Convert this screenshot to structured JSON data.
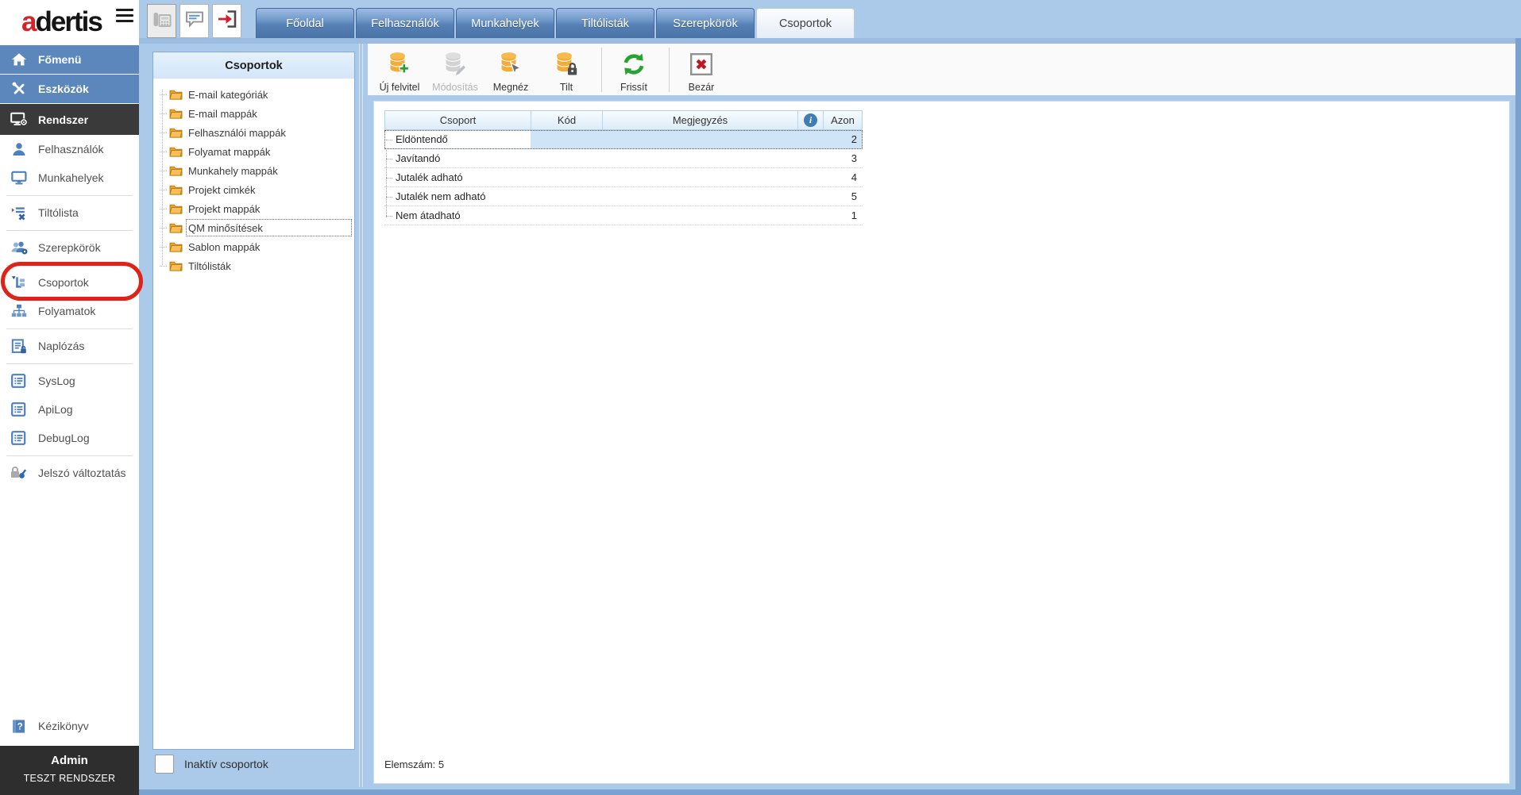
{
  "brand": {
    "logo_red": "a",
    "logo_rest": "dertis"
  },
  "topbar": {
    "window_icons": [
      "fax-icon",
      "comment-icon",
      "logout-icon"
    ],
    "tabs": [
      {
        "label": "Főoldal",
        "active": false
      },
      {
        "label": "Felhasználók",
        "active": false
      },
      {
        "label": "Munkahelyek",
        "active": false
      },
      {
        "label": "Tiltólisták",
        "active": false
      },
      {
        "label": "Szerepkörök",
        "active": false
      },
      {
        "label": "Csoportok",
        "active": true
      }
    ]
  },
  "sidebar": {
    "items": [
      {
        "label": "Főmenü"
      },
      {
        "label": "Eszközök"
      },
      {
        "label": "Rendszer"
      },
      {
        "label": "Felhasználók"
      },
      {
        "label": "Munkahelyek"
      },
      {
        "label": "Tiltólista"
      },
      {
        "label": "Szerepkörök"
      },
      {
        "label": "Csoportok",
        "annotated": true
      },
      {
        "label": "Folyamatok"
      },
      {
        "label": "Naplózás"
      },
      {
        "label": "SysLog"
      },
      {
        "label": "ApiLog"
      },
      {
        "label": "DebugLog"
      },
      {
        "label": "Jelszó változtatás"
      },
      {
        "label": "Kézikönyv"
      }
    ],
    "footer": {
      "user": "Admin",
      "system": "TESZT RENDSZER"
    }
  },
  "tree": {
    "title": "Csoportok",
    "items": [
      {
        "label": "E-mail kategóriák"
      },
      {
        "label": "E-mail mappák"
      },
      {
        "label": "Felhasználói mappák"
      },
      {
        "label": "Folyamat mappák"
      },
      {
        "label": "Munkahely mappák"
      },
      {
        "label": "Projekt cimkék"
      },
      {
        "label": "Projekt mappák"
      },
      {
        "label": "QM minősítések",
        "focused": true
      },
      {
        "label": "Sablon mappák"
      },
      {
        "label": "Tiltólisták"
      }
    ]
  },
  "toolbar": {
    "buttons": [
      {
        "label": "Új felvitel",
        "disabled": false
      },
      {
        "label": "Módosítás",
        "disabled": true
      },
      {
        "label": "Megnéz",
        "disabled": false
      },
      {
        "label": "Tilt",
        "disabled": false
      },
      {
        "label": "Frissít",
        "disabled": false
      },
      {
        "label": "Bezár",
        "disabled": false
      }
    ]
  },
  "grid": {
    "columns": {
      "csoport": "Csoport",
      "kod": "Kód",
      "megjegyzes": "Megjegyzés",
      "azon": "Azon"
    },
    "rows": [
      {
        "csoport": "Eldöntendő",
        "kod": "",
        "megjegyzes": "",
        "azon": "2",
        "selected": true
      },
      {
        "csoport": "Javítandó",
        "kod": "",
        "megjegyzes": "",
        "azon": "3",
        "selected": false
      },
      {
        "csoport": "Jutalék adható",
        "kod": "",
        "megjegyzes": "",
        "azon": "4",
        "selected": false
      },
      {
        "csoport": "Jutalék nem adható",
        "kod": "",
        "megjegyzes": "",
        "azon": "5",
        "selected": false
      },
      {
        "csoport": "Nem átadható",
        "kod": "",
        "megjegyzes": "",
        "azon": "1",
        "selected": false
      }
    ],
    "status": "Elemszám: 5"
  },
  "filters": {
    "inactive_label": "Inaktív csoportok",
    "checked": false
  },
  "colors": {
    "topbar_bg": "#abc9e8",
    "tab_blue": "#5681b4",
    "sidebar_blue": "#5b87bd",
    "sidebar_dark": "#3a3a3a",
    "selected_row": "#cfe4f6",
    "folder_orange": "#eda128",
    "db_orange": "#f5ab38",
    "refresh_green": "#28a42e",
    "close_red": "#c01723",
    "annotation_red": "#df2318",
    "info_badge": "#3e7eb2"
  }
}
